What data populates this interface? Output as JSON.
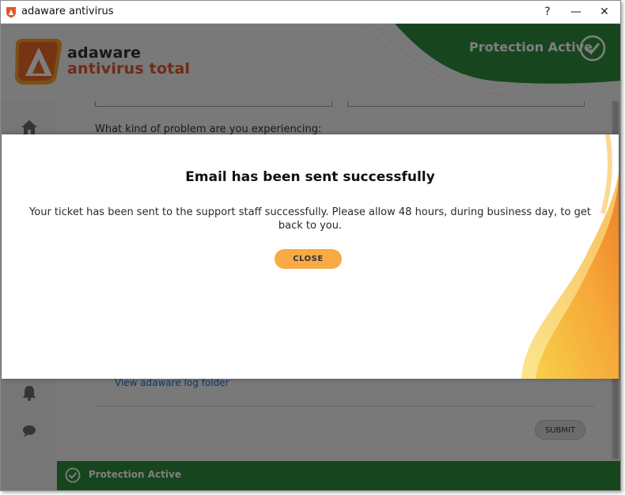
{
  "window": {
    "title": "adaware antivirus",
    "help_label": "?",
    "minimize_label": "—",
    "close_label": "✕"
  },
  "brand": {
    "line1": "adaware",
    "line2": "antivirus total"
  },
  "header": {
    "protection_label": "Protection Active"
  },
  "form": {
    "question": "What kind of problem are you experiencing:",
    "log_link": "View adaware log folder",
    "submit_label": "SUBMIT"
  },
  "status_bar": {
    "label": "Protection Active"
  },
  "dialog": {
    "title": "Email has been sent successfully",
    "message": "Your ticket has been sent to the support staff successfully. Please allow 48 hours, during business day, to get back to you.",
    "close_label": "CLOSE"
  },
  "sidebar_icons": [
    "home-icon",
    "bell-icon",
    "chat-icon"
  ],
  "colors": {
    "brand_orange": "#e2562b",
    "accent_green": "#2f8d3c",
    "close_button": "#f9aa46",
    "link_blue": "#1f6fc9"
  }
}
